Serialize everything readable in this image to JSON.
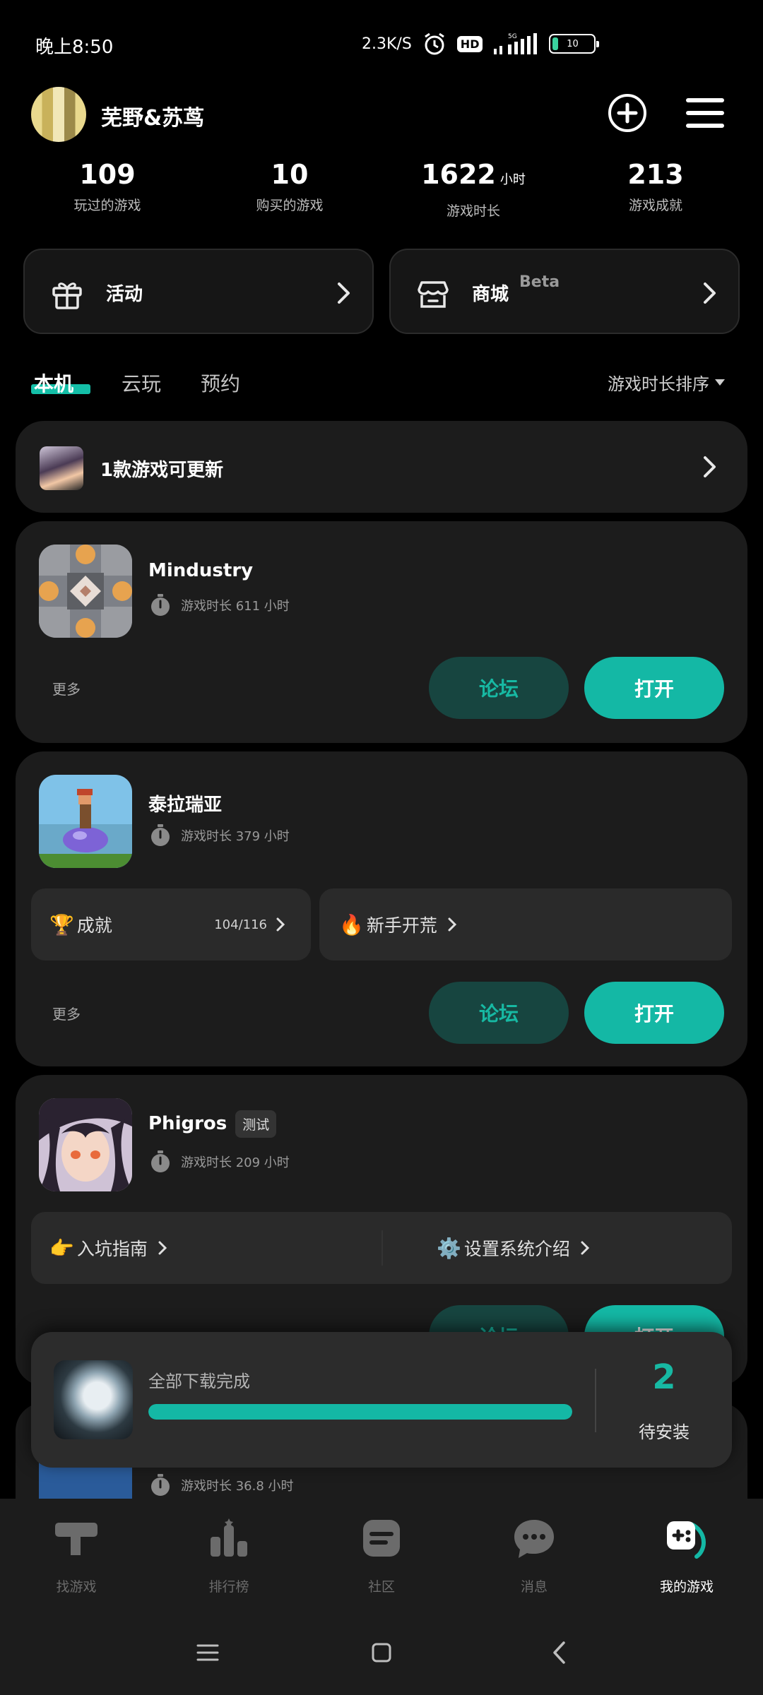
{
  "status_bar": {
    "time": "晚上8:50",
    "network_speed": "2.3K/S",
    "hd": "HD",
    "signal": "5G",
    "battery": "10"
  },
  "profile": {
    "username": "芜野&苏茑",
    "stats": [
      {
        "value": "109",
        "unit": "",
        "label": "玩过的游戏"
      },
      {
        "value": "10",
        "unit": "",
        "label": "购买的游戏"
      },
      {
        "value": "1622",
        "unit": "小时",
        "label": "游戏时长"
      },
      {
        "value": "213",
        "unit": "",
        "label": "游戏成就"
      }
    ]
  },
  "entries": {
    "activity_label": "活动",
    "store_label": "商城",
    "store_badge": "Beta"
  },
  "tabs": {
    "items": [
      "本机",
      "云玩",
      "预约"
    ],
    "active": "本机",
    "sort_label": "游戏时长排序"
  },
  "update_banner": {
    "text": "1款游戏可更新"
  },
  "games": [
    {
      "title": "Mindustry",
      "playtime": "游戏时长 611 小时",
      "more": "更多",
      "forum": "论坛",
      "open": "打开"
    },
    {
      "title": "泰拉瑞亚",
      "playtime": "游戏时长 379 小时",
      "achievement_label": "成就",
      "achievement_count": "104/116",
      "guide_label": "新手开荒",
      "more": "更多",
      "forum": "论坛",
      "open": "打开"
    },
    {
      "title": "Phigros",
      "tag": "测试",
      "playtime": "游戏时长 209 小时",
      "guide_label": "入坑指南",
      "settings_label": "设置系统介绍",
      "forum": "论坛",
      "open": "打开"
    },
    {
      "playtime": "游戏时长 36.8 小时"
    }
  ],
  "download_toast": {
    "title": "全部下载完成",
    "progress": 1.0,
    "pending_count": "2",
    "pending_label": "待安装"
  },
  "bottom_nav": {
    "items": [
      {
        "label": "找游戏",
        "icon": "find-game-icon"
      },
      {
        "label": "排行榜",
        "icon": "leaderboard-icon"
      },
      {
        "label": "社区",
        "icon": "community-icon"
      },
      {
        "label": "消息",
        "icon": "message-icon"
      },
      {
        "label": "我的游戏",
        "icon": "my-games-icon"
      }
    ],
    "active": "我的游戏"
  },
  "colors": {
    "accent": "#14b8a5",
    "forum_bg": "#174540",
    "card_bg": "#1c1c1c",
    "background": "#000000"
  }
}
